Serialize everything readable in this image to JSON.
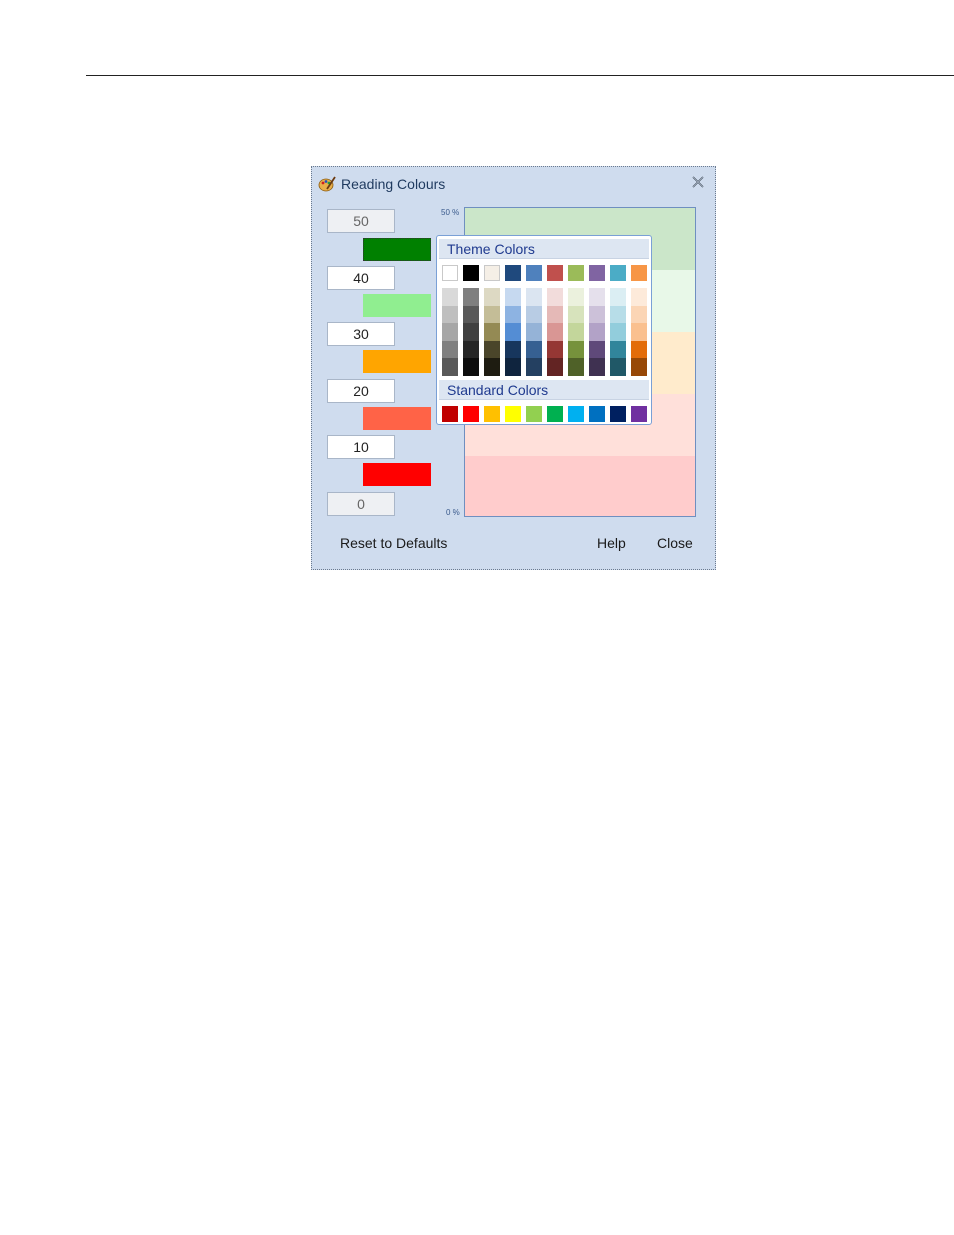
{
  "window": {
    "title": "Reading Colours",
    "icon": "palette-icon"
  },
  "thresholds": [
    {
      "value": "50",
      "disabled": true
    },
    {
      "value": "40",
      "disabled": false
    },
    {
      "value": "30",
      "disabled": false
    },
    {
      "value": "20",
      "disabled": false
    },
    {
      "value": "10",
      "disabled": false
    },
    {
      "value": "0",
      "disabled": true
    }
  ],
  "swatches": [
    "#008000",
    "#90ee90",
    "#ffa500",
    "#ff6347",
    "#ff0000"
  ],
  "scale": {
    "top_label": "50 %",
    "bottom_label": "0 %"
  },
  "preview_bands": [
    "#cbe6c9",
    "#e8f8e8",
    "#ffebcc",
    "#ffe0da",
    "#ffcccc"
  ],
  "palette": {
    "theme_label": "Theme Colors",
    "standard_label": "Standard Colors",
    "theme_top": [
      "#ffffff",
      "#000000",
      "#f5efe6",
      "#1f497d",
      "#4f81bd",
      "#c0504d",
      "#9bbb59",
      "#8064a2",
      "#4bacc6",
      "#f79646"
    ],
    "theme_shades": [
      [
        "#d9d9d9",
        "#bfbfbf",
        "#a6a6a6",
        "#808080",
        "#595959"
      ],
      [
        "#7f7f7f",
        "#595959",
        "#404040",
        "#262626",
        "#0d0d0d"
      ],
      [
        "#ddd9c3",
        "#c4bd97",
        "#948a54",
        "#4a452a",
        "#1e1c11"
      ],
      [
        "#c6d9f0",
        "#8db3e2",
        "#548dd4",
        "#17365d",
        "#0f243e"
      ],
      [
        "#dbe5f1",
        "#b8cce4",
        "#95b3d7",
        "#366092",
        "#244061"
      ],
      [
        "#f2dcdb",
        "#e5b9b7",
        "#d99694",
        "#953734",
        "#632423"
      ],
      [
        "#ebf1dd",
        "#d7e3bc",
        "#c3d69b",
        "#76923c",
        "#4f6128"
      ],
      [
        "#e5e0ec",
        "#ccc1d9",
        "#b2a2c7",
        "#5f497a",
        "#3f3151"
      ],
      [
        "#dbeef3",
        "#b7dde8",
        "#92cddc",
        "#31859b",
        "#205867"
      ],
      [
        "#fdeada",
        "#fbd5b5",
        "#fac08f",
        "#e36c09",
        "#974806"
      ]
    ],
    "standard": [
      "#c00000",
      "#ff0000",
      "#ffc000",
      "#ffff00",
      "#92d050",
      "#00b050",
      "#00b0f0",
      "#0070c0",
      "#002060",
      "#7030a0"
    ]
  },
  "buttons": {
    "reset": "Reset to Defaults",
    "help": "Help",
    "close": "Close"
  }
}
